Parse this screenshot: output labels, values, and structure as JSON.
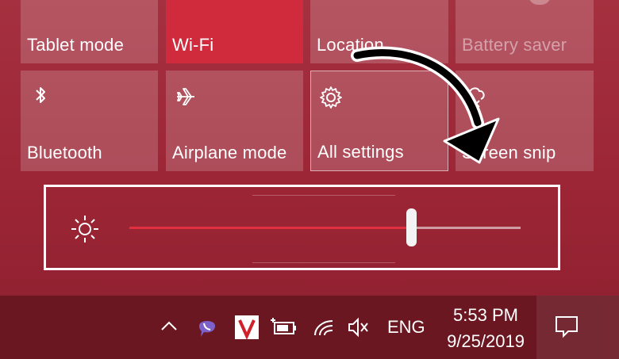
{
  "tiles": {
    "tablet_mode": "Tablet mode",
    "wifi": "Wi-Fi",
    "location": "Location",
    "battery_saver": "Battery saver",
    "bluetooth": "Bluetooth",
    "airplane_mode": "Airplane mode",
    "all_settings": "All settings",
    "screen_snip": "Screen snip"
  },
  "brightness": {
    "level_percent": 72
  },
  "taskbar": {
    "language": "ENG",
    "time": "5:53 PM",
    "date": "9/25/2019"
  },
  "colors": {
    "accent": "#d02b3c",
    "background": "#9b2535",
    "taskbar": "#6a1722"
  }
}
